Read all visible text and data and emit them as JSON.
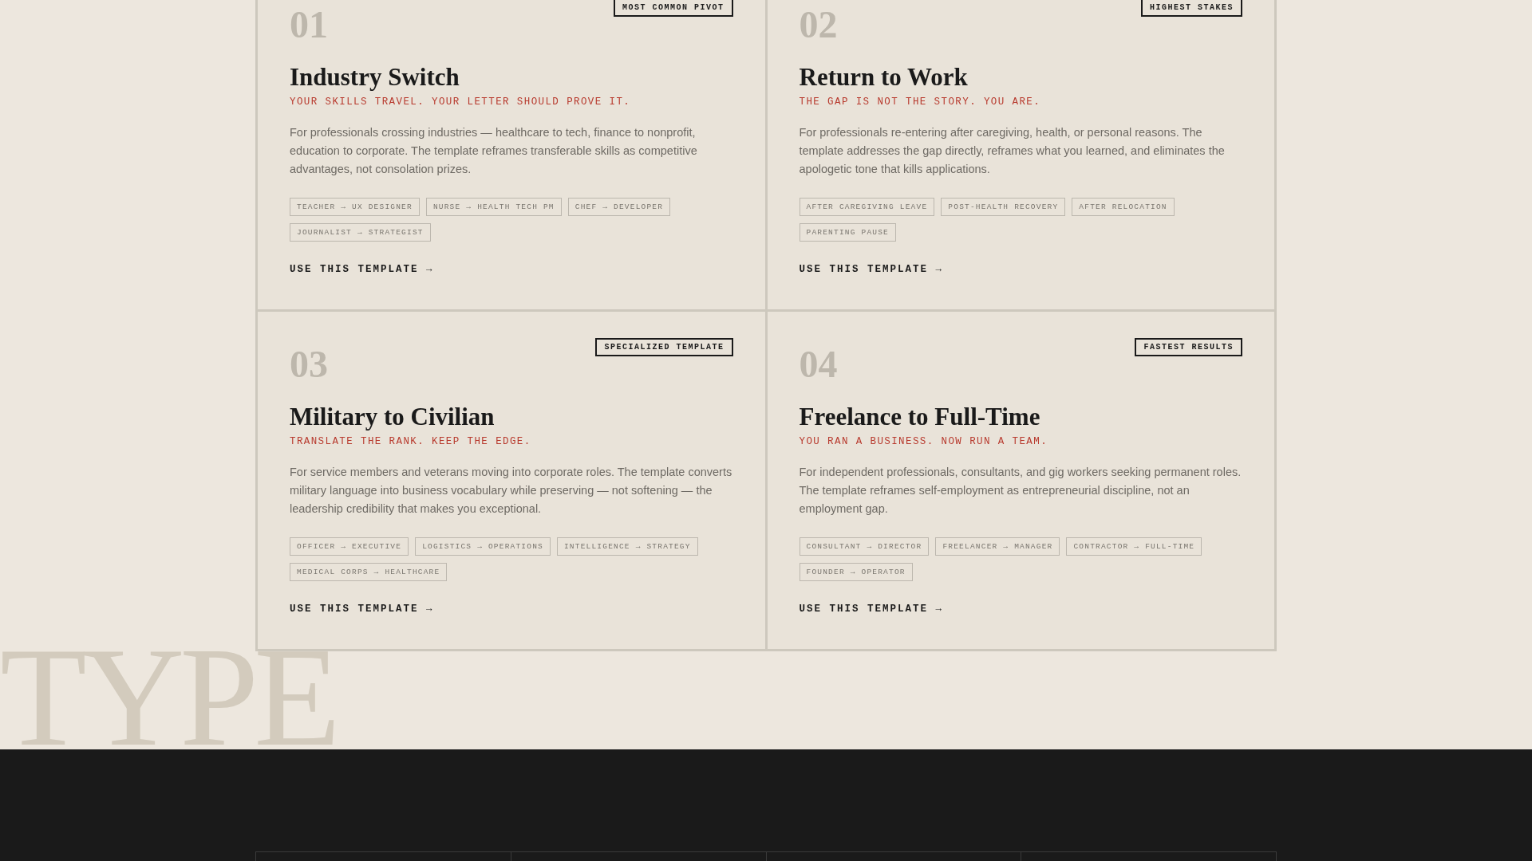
{
  "cards": [
    {
      "number": "01",
      "badge": "MOST COMMON PIVOT",
      "title": "Industry Switch",
      "tagline": "YOUR SKILLS TRAVEL. YOUR LETTER SHOULD PROVE IT.",
      "description": "For professionals crossing industries — healthcare to tech, finance to nonprofit, education to corporate. The template reframes transferable skills as competitive advantages, not consolation prizes.",
      "tags": [
        "TEACHER → UX DESIGNER",
        "NURSE → HEALTH TECH PM",
        "CHEF → DEVELOPER",
        "JOURNALIST → STRATEGIST"
      ],
      "cta": "USE THIS TEMPLATE →"
    },
    {
      "number": "02",
      "badge": "HIGHEST STAKES",
      "title": "Return to Work",
      "tagline": "THE GAP IS NOT THE STORY. YOU ARE.",
      "description": "For professionals re-entering after caregiving, health, or personal reasons. The template addresses the gap directly, reframes what you learned, and eliminates the apologetic tone that kills applications.",
      "tags": [
        "AFTER CAREGIVING LEAVE",
        "POST-HEALTH RECOVERY",
        "AFTER RELOCATION",
        "PARENTING PAUSE"
      ],
      "cta": "USE THIS TEMPLATE →"
    },
    {
      "number": "03",
      "badge": "SPECIALIZED TEMPLATE",
      "title": "Military to Civilian",
      "tagline": "TRANSLATE THE RANK. KEEP THE EDGE.",
      "description": "For service members and veterans moving into corporate roles. The template converts military language into business vocabulary while preserving — not softening — the leadership credibility that makes you exceptional.",
      "tags": [
        "OFFICER → EXECUTIVE",
        "LOGISTICS → OPERATIONS",
        "INTELLIGENCE → STRATEGY",
        "MEDICAL CORPS → HEALTHCARE"
      ],
      "cta": "USE THIS TEMPLATE →"
    },
    {
      "number": "04",
      "badge": "FASTEST RESULTS",
      "title": "Freelance to Full-Time",
      "tagline": "YOU RAN A BUSINESS. NOW RUN A TEAM.",
      "description": "For independent professionals, consultants, and gig workers seeking permanent roles. The template reframes self-employment as entrepreneurial discipline, not an employment gap.",
      "tags": [
        "CONSULTANT → DIRECTOR",
        "FREELANCER → MANAGER",
        "CONTRACTOR → FULL-TIME",
        "FOUNDER → OPERATOR"
      ],
      "cta": "USE THIS TEMPLATE →"
    }
  ],
  "background_word": "TYPE"
}
